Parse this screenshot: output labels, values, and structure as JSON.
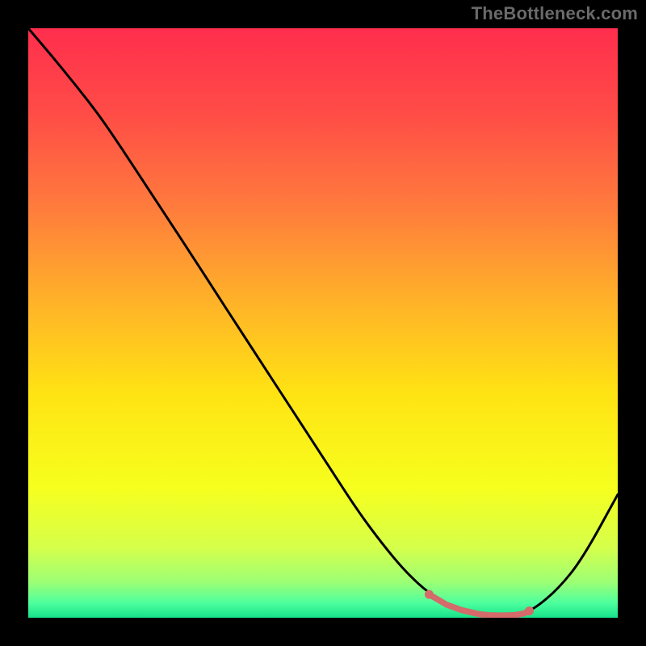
{
  "watermark": "TheBottleneck.com",
  "chart_data": {
    "type": "line",
    "title": "",
    "xlabel": "",
    "ylabel": "",
    "xlim": [
      0,
      100
    ],
    "ylim": [
      0,
      100
    ],
    "series": [
      {
        "name": "curve",
        "x": [
          0,
          4,
          8,
          12,
          16,
          20,
          24,
          28,
          32,
          36,
          40,
          44,
          48,
          52,
          56,
          60,
          64,
          68,
          72,
          76,
          80,
          83.5,
          86,
          90,
          94,
          100
        ],
        "values": [
          100,
          95.3,
          90.4,
          85.3,
          79.4,
          73.3,
          67.2,
          61.1,
          54.9,
          48.7,
          42.6,
          36.4,
          30.3,
          24.1,
          18.0,
          12.6,
          7.8,
          4.1,
          1.8,
          0.6,
          0.4,
          0.6,
          1.6,
          5.0,
          10.0,
          20.9
        ]
      }
    ],
    "markers": {
      "name": "highlight",
      "color": "#d46a6a",
      "x": [
        68,
        71,
        73.5,
        75,
        76.5,
        78,
        79.5,
        81,
        82.5,
        84,
        85
      ],
      "values": [
        3.95,
        2.2,
        1.3,
        0.95,
        0.6,
        0.45,
        0.4,
        0.4,
        0.45,
        0.7,
        1.15
      ]
    },
    "gradient_stops": [
      {
        "offset": 0.0,
        "color": "#ff2e4d"
      },
      {
        "offset": 0.14,
        "color": "#ff4b47"
      },
      {
        "offset": 0.3,
        "color": "#ff7a3d"
      },
      {
        "offset": 0.46,
        "color": "#ffb129"
      },
      {
        "offset": 0.62,
        "color": "#ffe313"
      },
      {
        "offset": 0.78,
        "color": "#f6ff1e"
      },
      {
        "offset": 0.88,
        "color": "#d6ff4a"
      },
      {
        "offset": 0.94,
        "color": "#9cff75"
      },
      {
        "offset": 0.975,
        "color": "#4dff9e"
      },
      {
        "offset": 1.0,
        "color": "#17e28a"
      }
    ]
  }
}
